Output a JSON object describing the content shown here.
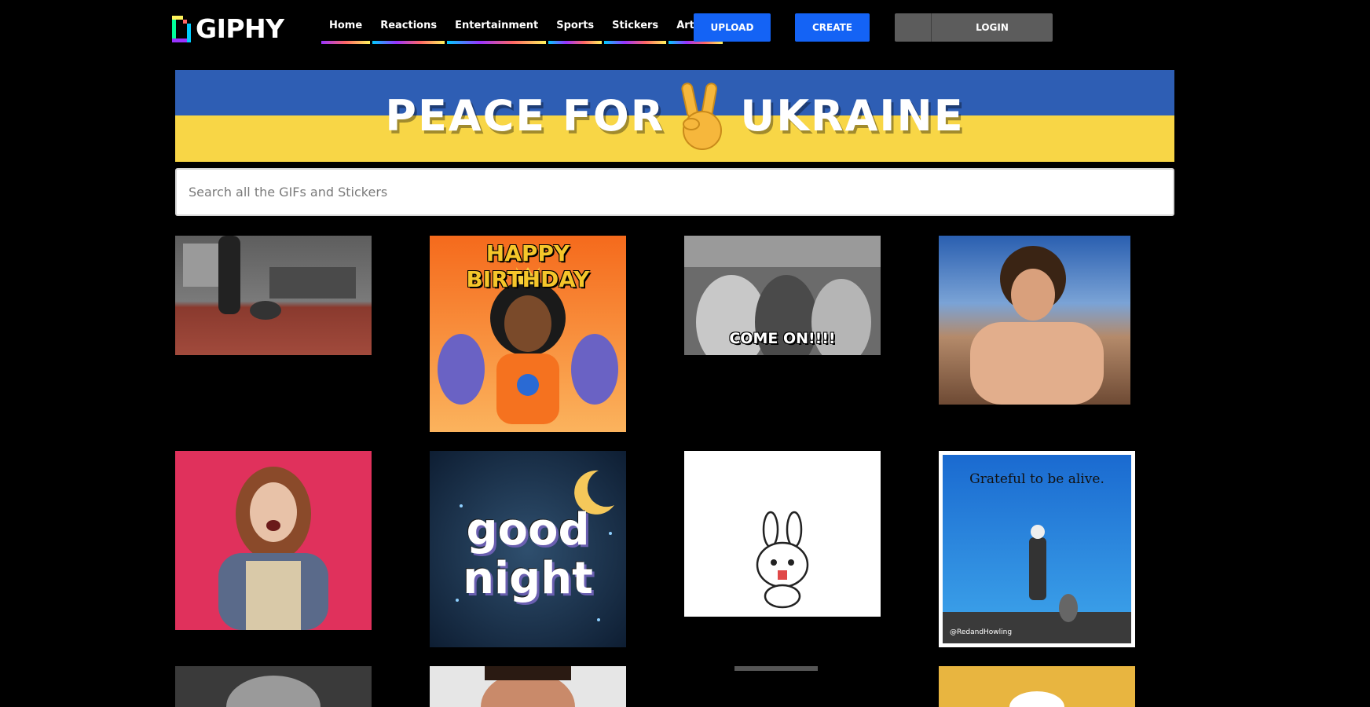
{
  "header": {
    "logo_text": "GIPHY",
    "nav": [
      {
        "label": "Home",
        "name": "nav-home"
      },
      {
        "label": "Reactions",
        "name": "nav-reactions"
      },
      {
        "label": "Entertainment",
        "name": "nav-entertainment"
      },
      {
        "label": "Sports",
        "name": "nav-sports"
      },
      {
        "label": "Stickers",
        "name": "nav-stickers"
      },
      {
        "label": "Artists",
        "name": "nav-artists"
      }
    ],
    "upload_label": "UPLOAD",
    "create_label": "CREATE",
    "login_label": "LOGIN"
  },
  "banner": {
    "text_left": "PEACE FOR",
    "text_right": "UKRAINE",
    "icon": "peace-hand-icon"
  },
  "search": {
    "placeholder": "Search all the GIFs and Stickers"
  },
  "gifs": [
    {
      "name": "gif-gym-bag"
    },
    {
      "name": "gif-happy-birthday",
      "text": "HAPPY BIRTHDAY"
    },
    {
      "name": "gif-come-on",
      "text": "COME ON!!!!"
    },
    {
      "name": "gif-shirtless-man"
    },
    {
      "name": "gif-excited-woman"
    },
    {
      "name": "gif-good-night",
      "text": "good night"
    },
    {
      "name": "gif-bunny-sticker"
    },
    {
      "name": "gif-grateful",
      "text": "Grateful to be alive.",
      "credit": "@RedandHowling"
    }
  ],
  "colors": {
    "accent_blue": "#1463f5",
    "ukraine_blue": "#2e5eb4",
    "ukraine_yellow": "#f8d646"
  }
}
